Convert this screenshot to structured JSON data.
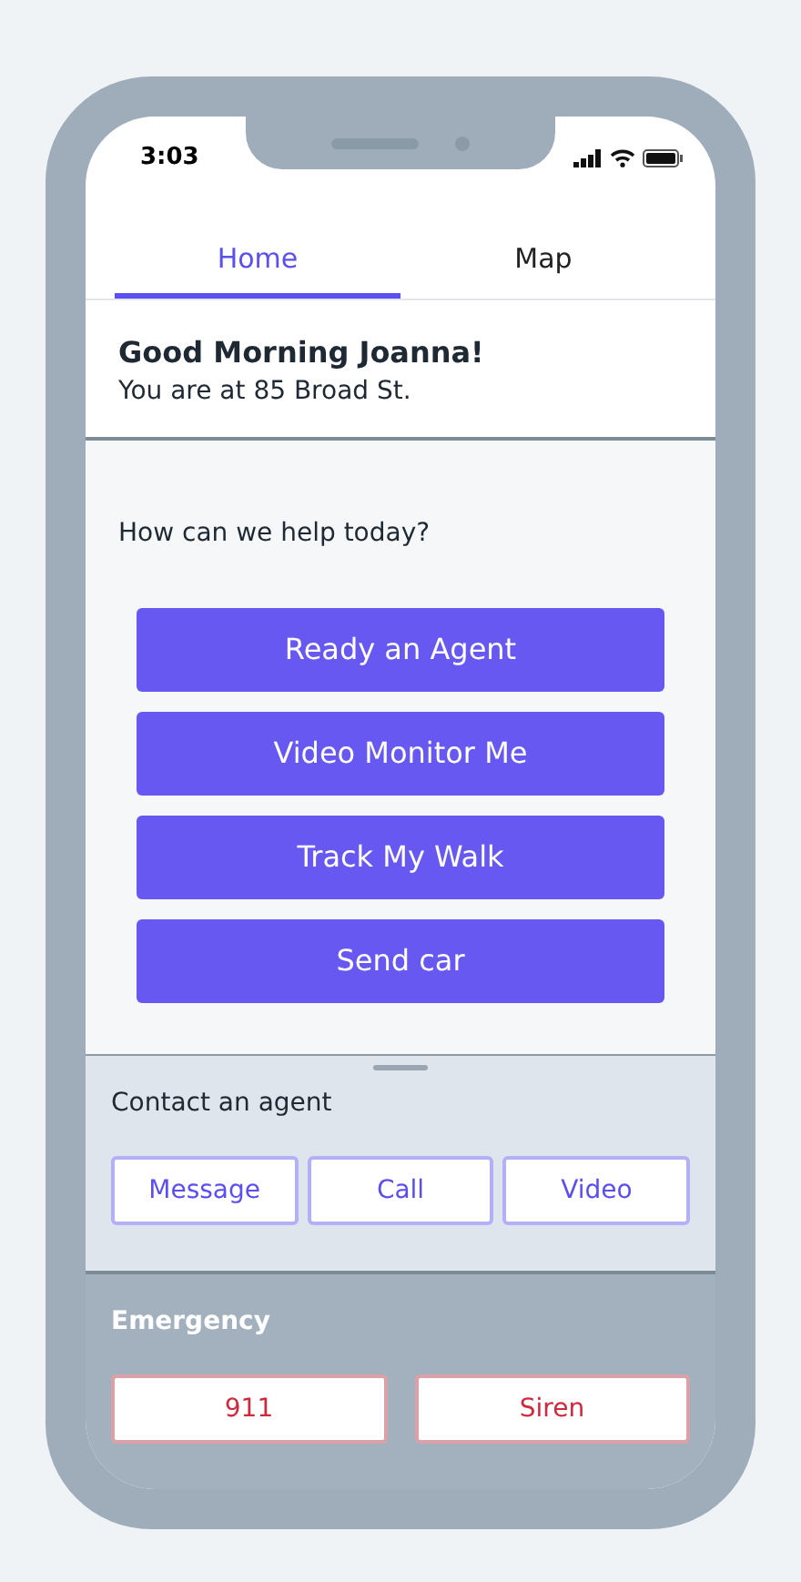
{
  "status_bar": {
    "time": "3:03"
  },
  "tabs": [
    {
      "label": "Home",
      "selected": true
    },
    {
      "label": "Map",
      "selected": false
    }
  ],
  "greeting": {
    "title": "Good Morning Joanna!",
    "location": "You are at 85 Broad St."
  },
  "help": {
    "prompt": "How can we help today?",
    "actions": [
      "Ready an Agent",
      "Video Monitor Me",
      "Track My Walk",
      "Send car"
    ]
  },
  "contact": {
    "title": "Contact an agent",
    "buttons": [
      "Message",
      "Call",
      "Video"
    ]
  },
  "emergency": {
    "title": "Emergency",
    "buttons": [
      "911",
      "Siren"
    ]
  }
}
